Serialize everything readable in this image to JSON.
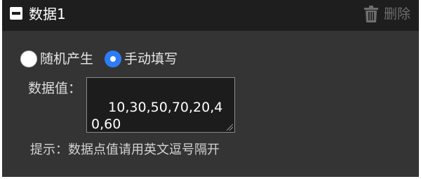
{
  "header": {
    "title": "数据1",
    "collapse_icon": "collapse-minus-icon",
    "delete_label": "删除",
    "delete_icon": "trash-icon"
  },
  "source": {
    "options": [
      {
        "label": "随机产生",
        "selected": false
      },
      {
        "label": "手动填写",
        "selected": true
      }
    ]
  },
  "values_field": {
    "label": "数据值：",
    "value": "10,30,50,70,20,40,60"
  },
  "hint": "提示：数据点值请用英文逗号隔开",
  "colors": {
    "panel_bg": "#343434",
    "header_bg": "#1e1e1e",
    "accent": "#2d7cf6",
    "muted": "#6e6e6e"
  }
}
